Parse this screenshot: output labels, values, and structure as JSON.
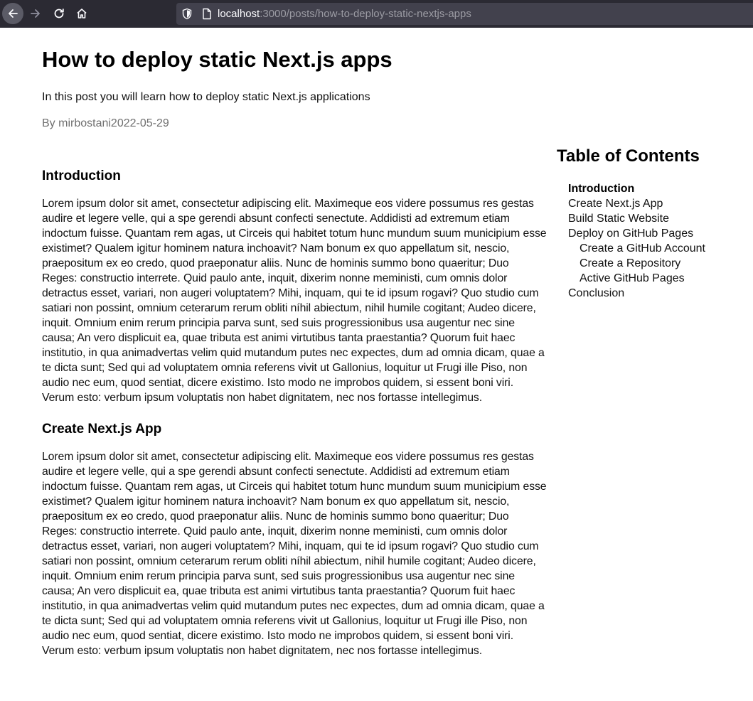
{
  "browser": {
    "url_host": "localhost",
    "url_rest": ":3000/posts/how-to-deploy-static-nextjs-apps",
    "icons": {
      "back": "arrow-left-icon",
      "forward": "arrow-right-icon",
      "reload": "reload-icon",
      "home": "home-icon",
      "tracking_protection": "shield-icon",
      "page": "page-icon"
    },
    "colors": {
      "toolbar": "#2b2a33",
      "urlbar": "#42414d"
    }
  },
  "post": {
    "title": "How to deploy static Next.js apps",
    "description": "In this post you will learn how to deploy static Next.js applications",
    "meta": "By mirbostani2022-05-29",
    "sections": [
      {
        "title": "Introduction",
        "body": "Lorem ipsum dolor sit amet, consectetur adipiscing elit. Maximeque eos videre possumus res gestas audire et legere velle, qui a spe gerendi absunt confecti senectute. Addidisti ad extremum etiam indoctum fuisse. Quantam rem agas, ut Circeis qui habitet totum hunc mundum suum municipium esse existimet? Qualem igitur hominem natura inchoavit? Nam bonum ex quo appellatum sit, nescio, praepositum ex eo credo, quod praeponatur aliis. Nunc de hominis summo bono quaeritur; Duo Reges: constructio interrete. Quid paulo ante, inquit, dixerim nonne meministi, cum omnis dolor detractus esset, variari, non augeri voluptatem? Mihi, inquam, qui te id ipsum rogavi? Quo studio cum satiari non possint, omnium ceterarum rerum obliti níhil abiectum, nihil humile cogitant; Audeo dicere, inquit. Omnium enim rerum principia parva sunt, sed suis progressionibus usa augentur nec sine causa; An vero displicuit ea, quae tributa est animi virtutibus tanta praestantia? Quorum fuit haec institutio, in qua animadvertas velim quid mutandum putes nec expectes, dum ad omnia dicam, quae a te dicta sunt; Sed qui ad voluptatem omnia referens vivit ut Gallonius, loquitur ut Frugi ille Piso, non audio nec eum, quod sentiat, dicere existimo. Isto modo ne improbos quidem, si essent boni viri. Verum esto: verbum ipsum voluptatis non habet dignitatem, nec nos fortasse intellegimus."
      },
      {
        "title": "Create Next.js App",
        "body": "Lorem ipsum dolor sit amet, consectetur adipiscing elit. Maximeque eos videre possumus res gestas audire et legere velle, qui a spe gerendi absunt confecti senectute. Addidisti ad extremum etiam indoctum fuisse. Quantam rem agas, ut Circeis qui habitet totum hunc mundum suum municipium esse existimet? Qualem igitur hominem natura inchoavit? Nam bonum ex quo appellatum sit, nescio, praepositum ex eo credo, quod praeponatur aliis. Nunc de hominis summo bono quaeritur; Duo Reges: constructio interrete. Quid paulo ante, inquit, dixerim nonne meministi, cum omnis dolor detractus esset, variari, non augeri voluptatem? Mihi, inquam, qui te id ipsum rogavi? Quo studio cum satiari non possint, omnium ceterarum rerum obliti níhil abiectum, nihil humile cogitant; Audeo dicere, inquit. Omnium enim rerum principia parva sunt, sed suis progressionibus usa augentur nec sine causa; An vero displicuit ea, quae tributa est animi virtutibus tanta praestantia? Quorum fuit haec institutio, in qua animadvertas velim quid mutandum putes nec expectes, dum ad omnia dicam, quae a te dicta sunt; Sed qui ad voluptatem omnia referens vivit ut Gallonius, loquitur ut Frugi ille Piso, non audio nec eum, quod sentiat, dicere existimo. Isto modo ne improbos quidem, si essent boni viri. Verum esto: verbum ipsum voluptatis non habet dignitatem, nec nos fortasse intellegimus."
      }
    ]
  },
  "toc": {
    "title": "Table of Contents",
    "items": [
      {
        "label": "Introduction",
        "level": 2,
        "active": true
      },
      {
        "label": "Create Next.js App",
        "level": 2,
        "active": false
      },
      {
        "label": "Build Static Website",
        "level": 2,
        "active": false
      },
      {
        "label": "Deploy on GitHub Pages",
        "level": 2,
        "active": false
      },
      {
        "label": "Create a GitHub Account",
        "level": 3,
        "active": false
      },
      {
        "label": "Create a Repository",
        "level": 3,
        "active": false
      },
      {
        "label": "Active GitHub Pages",
        "level": 3,
        "active": false
      },
      {
        "label": "Conclusion",
        "level": 2,
        "active": false
      }
    ]
  }
}
